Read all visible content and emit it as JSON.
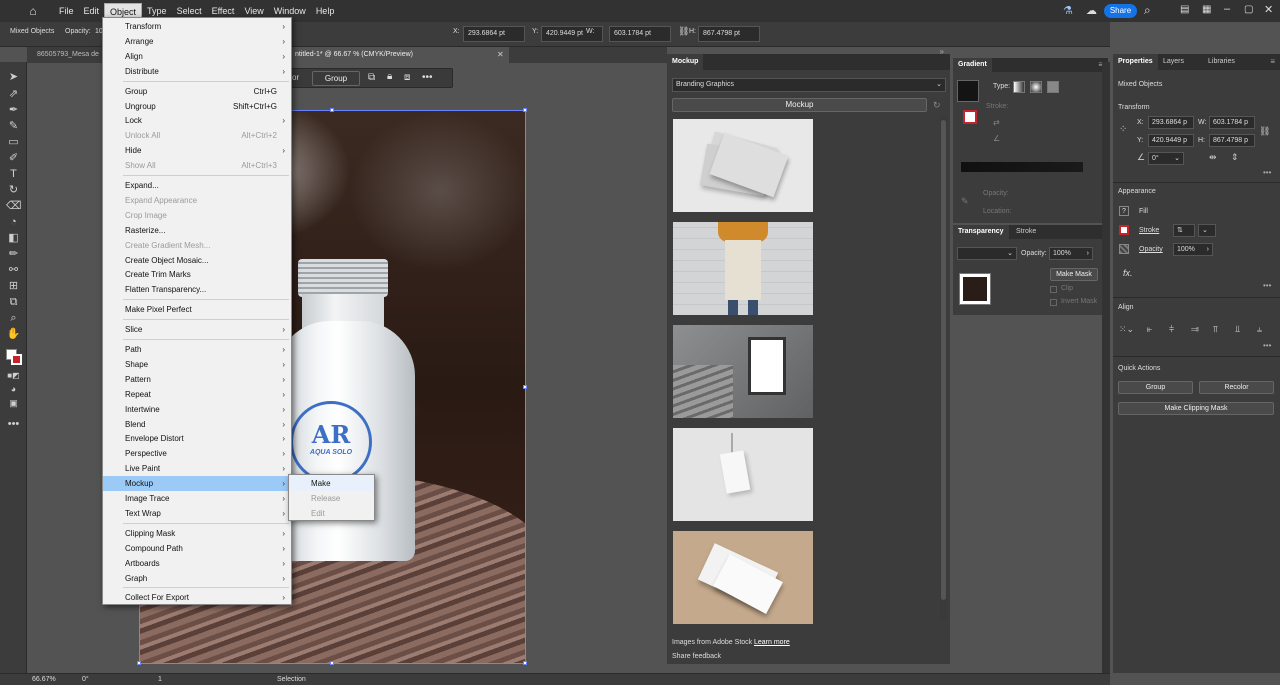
{
  "menubar": {
    "items": [
      "File",
      "Edit",
      "Object",
      "Type",
      "Select",
      "Effect",
      "View",
      "Window",
      "Help"
    ],
    "share": "Share"
  },
  "control_bar": {
    "selection": "Mixed Objects",
    "opacity_label": "Opacity:",
    "opacity_value": "10",
    "x_label": "X:",
    "x": "293.6864 pt",
    "y_label": "Y:",
    "y": "420.9449 pt",
    "w_label": "W:",
    "w": "603.1784 pt",
    "h_label": "H:",
    "h": "867.4798 pt"
  },
  "doc_tabs": {
    "first": "86505793_Mesa de",
    "second": "ntitled-1* @ 66.67 % (CMYK/Preview)"
  },
  "context_bar": {
    "left": "or",
    "group": "Group",
    "more": "•••"
  },
  "artwork": {
    "logo_top": "AR",
    "logo_bottom": "AQUA SOLO"
  },
  "object_menu": [
    {
      "label": "Transform",
      "shortcut": "",
      "arrow": true
    },
    {
      "label": "Arrange",
      "shortcut": "",
      "arrow": true
    },
    {
      "label": "Align",
      "shortcut": "",
      "arrow": true
    },
    {
      "label": "Distribute",
      "shortcut": "",
      "arrow": true
    },
    {
      "label": "Group",
      "shortcut": "Ctrl+G",
      "arrow": false
    },
    {
      "label": "Ungroup",
      "shortcut": "Shift+Ctrl+G",
      "arrow": false
    },
    {
      "label": "Lock",
      "shortcut": "",
      "arrow": true
    },
    {
      "label": "Unlock All",
      "shortcut": "Alt+Ctrl+2",
      "arrow": false,
      "disabled": true
    },
    {
      "label": "Hide",
      "shortcut": "",
      "arrow": true
    },
    {
      "label": "Show All",
      "shortcut": "Alt+Ctrl+3",
      "arrow": false,
      "disabled": true
    },
    {
      "label": "Expand...",
      "shortcut": "",
      "arrow": false
    },
    {
      "label": "Expand Appearance",
      "shortcut": "",
      "arrow": false,
      "disabled": true
    },
    {
      "label": "Crop Image",
      "shortcut": "",
      "arrow": false,
      "disabled": true
    },
    {
      "label": "Rasterize...",
      "shortcut": "",
      "arrow": false
    },
    {
      "label": "Create Gradient Mesh...",
      "shortcut": "",
      "arrow": false,
      "disabled": true
    },
    {
      "label": "Create Object Mosaic...",
      "shortcut": "",
      "arrow": false
    },
    {
      "label": "Create Trim Marks",
      "shortcut": "",
      "arrow": false
    },
    {
      "label": "Flatten Transparency...",
      "shortcut": "",
      "arrow": false
    },
    {
      "label": "Make Pixel Perfect",
      "shortcut": "",
      "arrow": false
    },
    {
      "label": "Slice",
      "shortcut": "",
      "arrow": true
    },
    {
      "label": "Path",
      "shortcut": "",
      "arrow": true
    },
    {
      "label": "Shape",
      "shortcut": "",
      "arrow": true
    },
    {
      "label": "Pattern",
      "shortcut": "",
      "arrow": true
    },
    {
      "label": "Repeat",
      "shortcut": "",
      "arrow": true
    },
    {
      "label": "Intertwine",
      "shortcut": "",
      "arrow": true
    },
    {
      "label": "Blend",
      "shortcut": "",
      "arrow": true
    },
    {
      "label": "Envelope Distort",
      "shortcut": "",
      "arrow": true
    },
    {
      "label": "Perspective",
      "shortcut": "",
      "arrow": true
    },
    {
      "label": "Live Paint",
      "shortcut": "",
      "arrow": true
    },
    {
      "label": "Mockup",
      "shortcut": "",
      "arrow": true,
      "highlighted": true
    },
    {
      "label": "Image Trace",
      "shortcut": "",
      "arrow": true
    },
    {
      "label": "Text Wrap",
      "shortcut": "",
      "arrow": true
    },
    {
      "label": "Clipping Mask",
      "shortcut": "",
      "arrow": true
    },
    {
      "label": "Compound Path",
      "shortcut": "",
      "arrow": true
    },
    {
      "label": "Artboards",
      "shortcut": "",
      "arrow": true
    },
    {
      "label": "Graph",
      "shortcut": "",
      "arrow": true
    },
    {
      "label": "Collect For Export",
      "shortcut": "",
      "arrow": true
    }
  ],
  "mockup_submenu": [
    {
      "label": "Make",
      "disabled": false
    },
    {
      "label": "Release",
      "disabled": true
    },
    {
      "label": "Edit",
      "disabled": true
    }
  ],
  "mockup_panel": {
    "tab": "Mockup",
    "dropdown": "Branding Graphics",
    "button": "Mockup",
    "footer_text": "Images from Adobe Stock",
    "learn_more": "Learn more",
    "share_feedback": "Share feedback"
  },
  "gradient_panel": {
    "tab": "Gradient",
    "type_label": "Type:",
    "stroke_label": "Stroke:",
    "opacity_label": "Opacity:",
    "location_label": "Location:"
  },
  "transparency_panel": {
    "tab1": "Transparency",
    "tab2": "Stroke",
    "opacity_label": "Opacity:",
    "opacity_value": "100%",
    "make_mask": "Make Mask",
    "clip": "Clip",
    "invert_mask": "Invert Mask"
  },
  "properties_panel": {
    "tabs": [
      "Properties",
      "Layers",
      "Libraries"
    ],
    "selection": "Mixed Objects",
    "transform_title": "Transform",
    "x_label": "X:",
    "x": "293.6864 p",
    "y_label": "Y:",
    "y": "420.9449 p",
    "w_label": "W:",
    "w": "603.1784 p",
    "h_label": "H:",
    "h": "867.4798 p",
    "angle": "0°",
    "appearance_title": "Appearance",
    "fill": "Fill",
    "stroke": "Stroke",
    "opacity": "Opacity",
    "opacity_value": "100%",
    "fx": "fx.",
    "align_title": "Align",
    "quick_actions_title": "Quick Actions",
    "group_btn": "Group",
    "recolor_btn": "Recolor",
    "clipping_btn": "Make Clipping Mask"
  },
  "status_bar": {
    "zoom": "66.67%",
    "angle": "0°",
    "artboard": "1",
    "tool": "Selection"
  },
  "colors": {
    "menu_highlight": "#9bcaf7",
    "share": "#1473e6",
    "selection_outline": "#6a84ff"
  }
}
